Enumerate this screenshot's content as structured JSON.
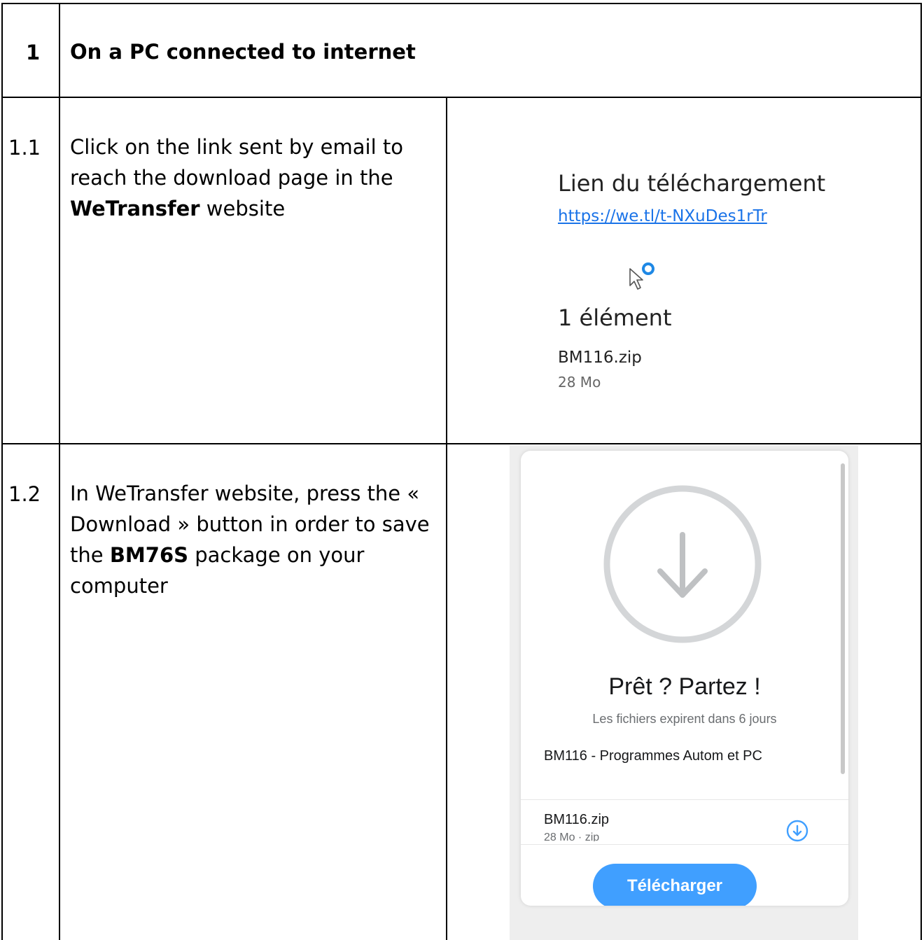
{
  "section": {
    "number": "1",
    "title": "On a PC connected to internet"
  },
  "steps": [
    {
      "number": "1.1",
      "text_a": "Click on the link sent by email to reach the download page in the ",
      "text_bold": "WeTransfer",
      "text_b": " website"
    },
    {
      "number": "1.2",
      "text_a": "In WeTransfer website, press the « Download » button in order to save the ",
      "text_bold": "BM76S",
      "text_b": " package on your computer"
    }
  ],
  "email_screenshot": {
    "title": "Lien du téléchargement",
    "link": "https://we.tl/t-NXuDes1rTr",
    "item_count": "1 élément",
    "file_name": "BM116.zip",
    "file_size": "28 Mo",
    "cursor_icon": "pointer-cursor-icon"
  },
  "wetransfer_screenshot": {
    "heading": "Prêt ? Partez !",
    "expiry": "Les fichiers expirent dans 6 jours",
    "transfer_title": "BM116 - Programmes Autom et PC",
    "file_name": "BM116.zip",
    "file_meta": "28 Mo · zip",
    "download_button": "Télécharger",
    "accent_color": "#409fff",
    "icons": [
      "download-circle-icon",
      "file-download-icon"
    ]
  }
}
